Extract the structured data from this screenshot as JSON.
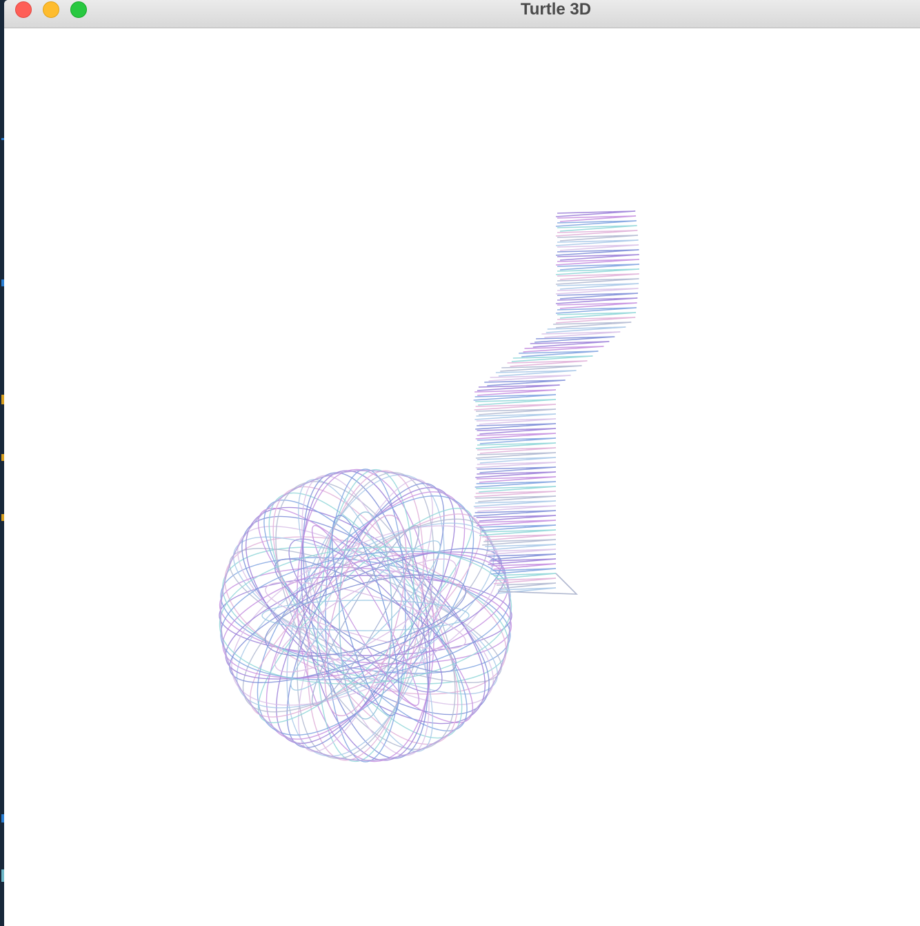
{
  "window": {
    "title": "Turtle 3D"
  },
  "palette": [
    "#9b7fd8",
    "#c58fe0",
    "#7fa3e0",
    "#8fd6d8",
    "#e0b0d8",
    "#b0b8d0",
    "#a8c8e8",
    "#d8c0e8",
    "#7f8fd8"
  ],
  "colors": {
    "titlebar": "#e3e3e3",
    "close": "#fe5f57",
    "minimize": "#febc2e",
    "maximize": "#28c840",
    "canvas": "#ffffff"
  },
  "icons": {
    "close": "close-traffic-light",
    "minimize": "minimize-traffic-light",
    "maximize": "maximize-traffic-light"
  }
}
